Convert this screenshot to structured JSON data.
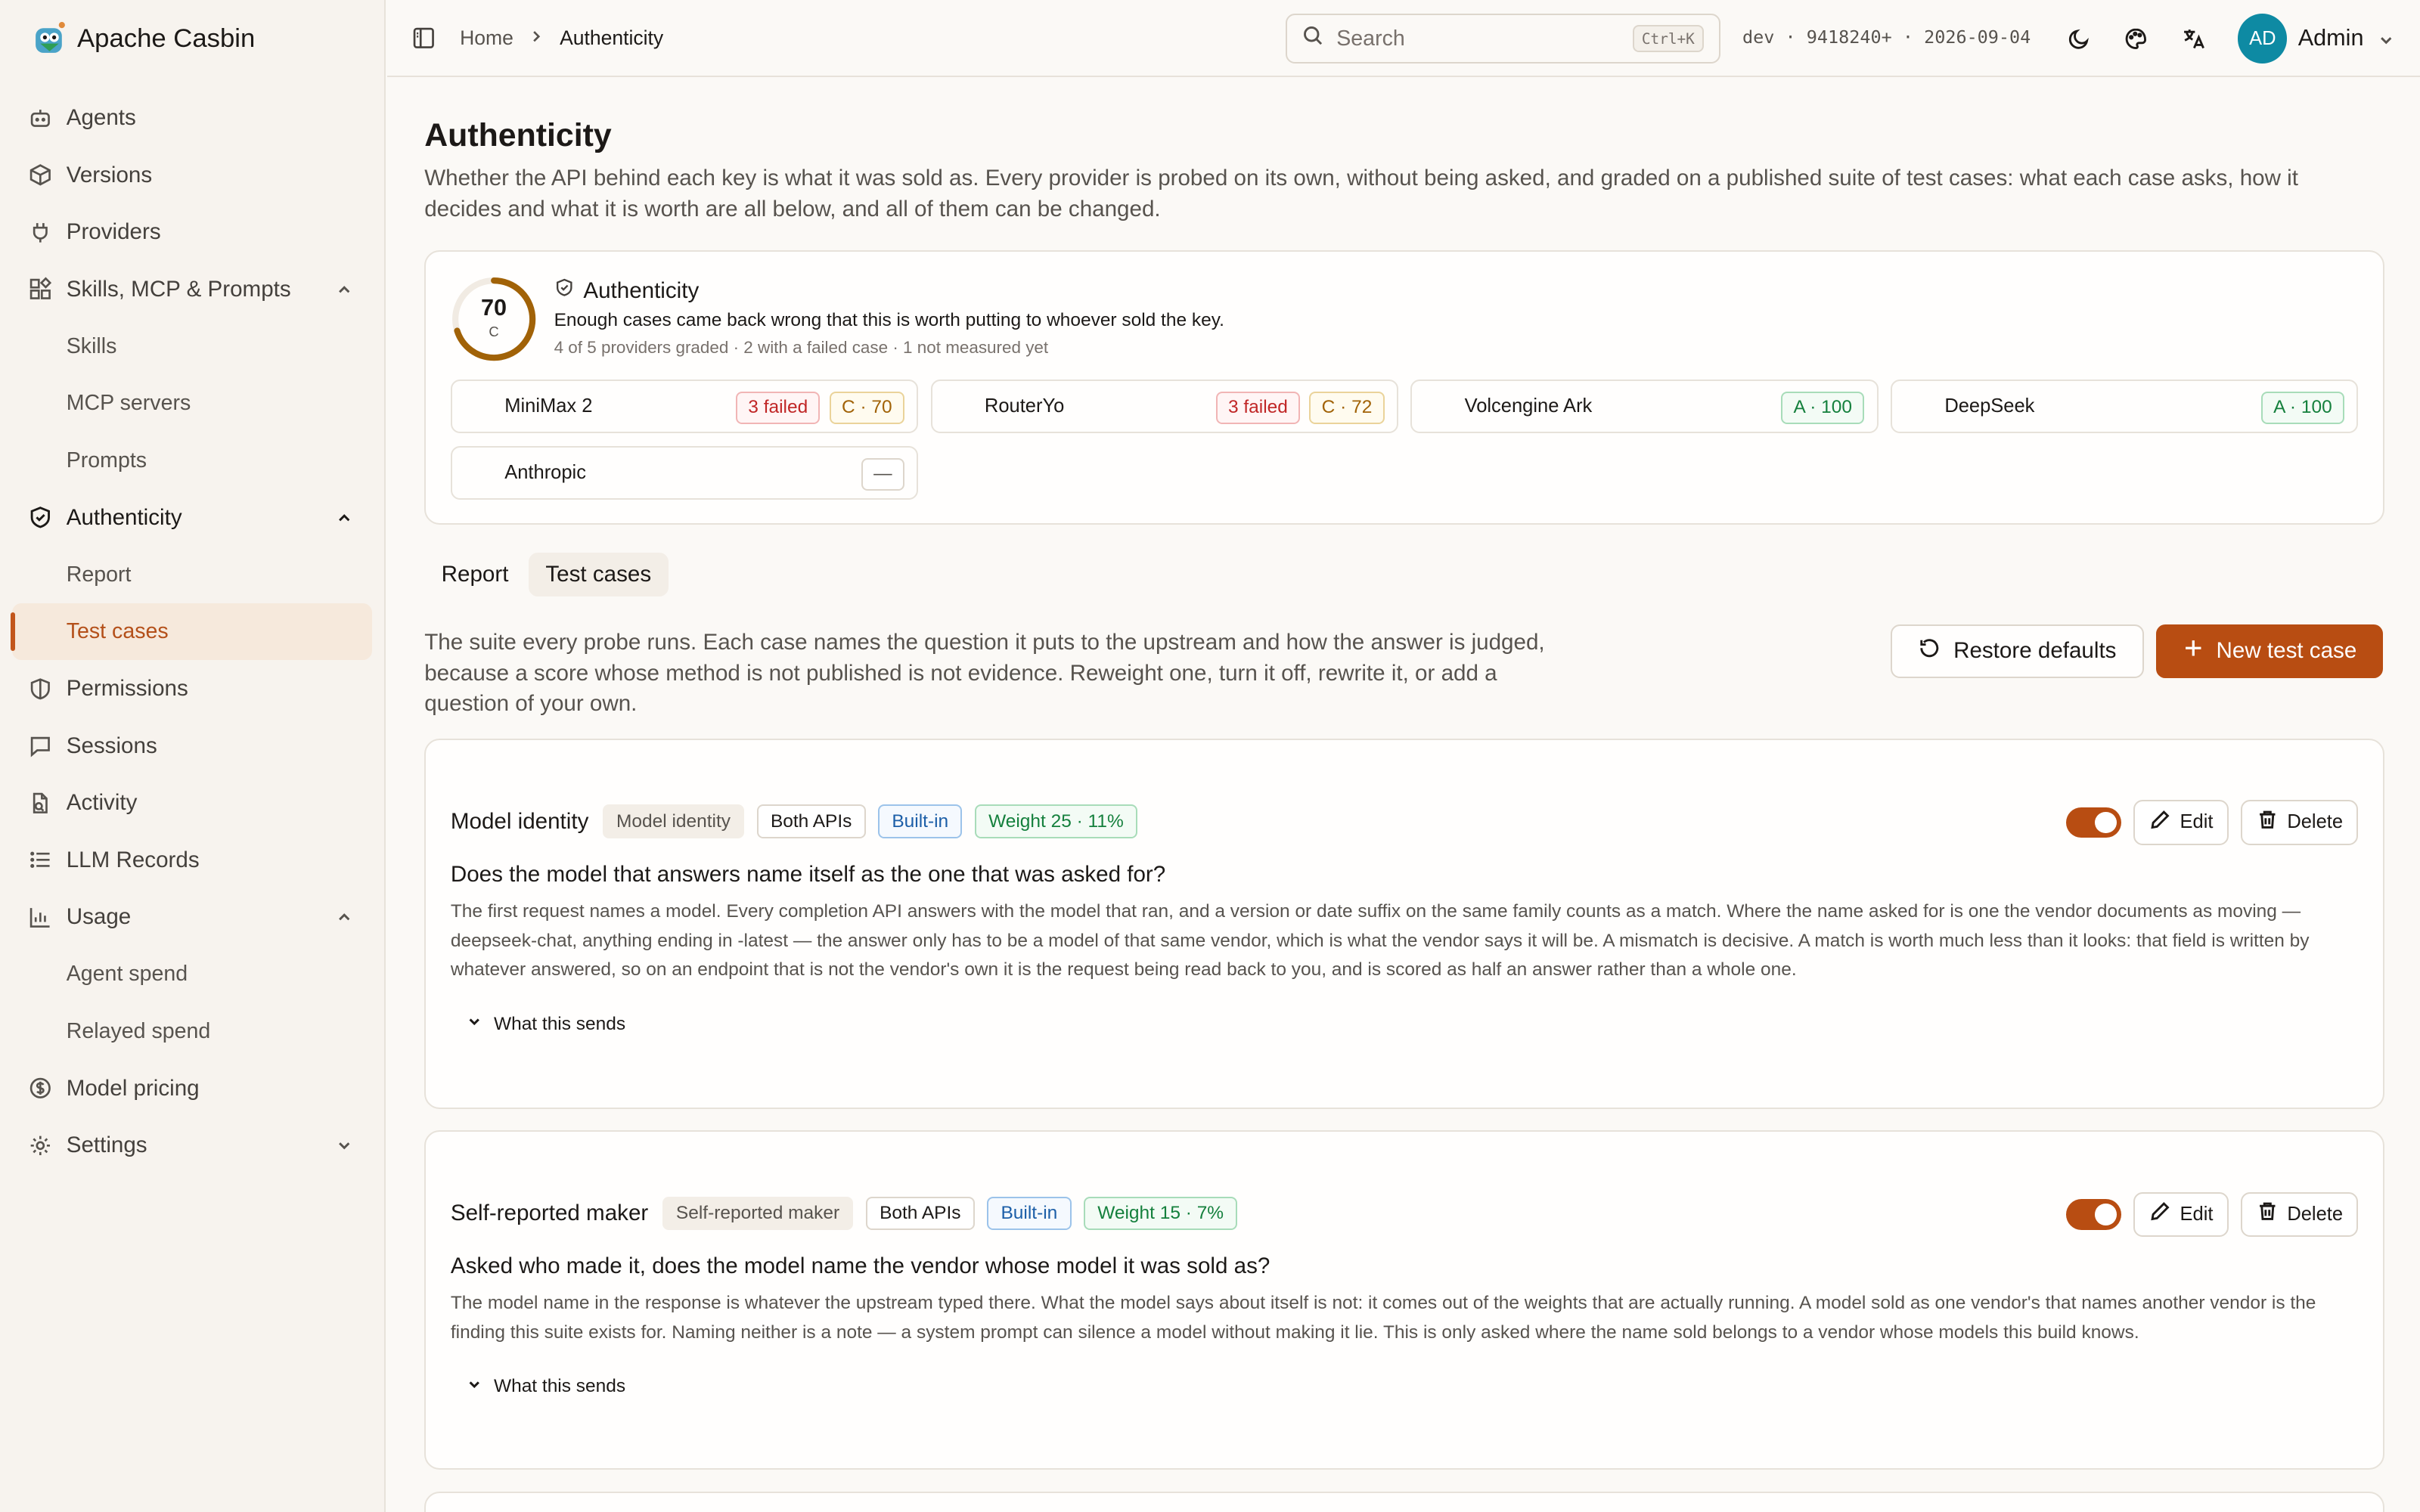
{
  "brand": {
    "name": "Apache Casbin"
  },
  "sidebar": {
    "items": [
      {
        "label": "Agents",
        "icon": "bot-icon"
      },
      {
        "label": "Versions",
        "icon": "package-icon"
      },
      {
        "label": "Providers",
        "icon": "plug-icon"
      },
      {
        "label": "Skills, MCP & Prompts",
        "icon": "blocks-icon",
        "expanded": true
      },
      {
        "label": "Skills",
        "sub": true
      },
      {
        "label": "MCP servers",
        "sub": true
      },
      {
        "label": "Prompts",
        "sub": true
      },
      {
        "label": "Authenticity",
        "icon": "shield-check-icon",
        "expanded": true
      },
      {
        "label": "Report",
        "sub": true
      },
      {
        "label": "Test cases",
        "sub": true,
        "active": true
      },
      {
        "label": "Permissions",
        "icon": "shield-icon"
      },
      {
        "label": "Sessions",
        "icon": "message-icon"
      },
      {
        "label": "Activity",
        "icon": "activity-icon"
      },
      {
        "label": "LLM Records",
        "icon": "list-icon"
      },
      {
        "label": "Usage",
        "icon": "bar-chart-icon",
        "expanded": true
      },
      {
        "label": "Agent spend",
        "sub": true
      },
      {
        "label": "Relayed spend",
        "sub": true
      },
      {
        "label": "Model pricing",
        "icon": "dollar-icon"
      },
      {
        "label": "Settings",
        "icon": "gear-icon",
        "collapsed": true
      }
    ]
  },
  "topbar": {
    "breadcrumb": [
      "Home",
      "Authenticity"
    ],
    "search_placeholder": "Search",
    "search_shortcut": "Ctrl+K",
    "build": "dev · 9418240+ · 2026-09-04",
    "avatar_initials": "AD",
    "user_name": "Admin"
  },
  "page": {
    "title": "Authenticity",
    "description": "Whether the API behind each key is what it was sold as. Every provider is probed on its own, without being asked, and graded on a published suite of test cases: what each case asks, how it decides and what it is worth are all below, and all of them can be changed."
  },
  "summary": {
    "score": "70",
    "grade": "C",
    "score_fraction": 0.7,
    "title": "Authenticity",
    "subtitle": "Enough cases came back wrong that this is worth putting to whoever sold the key.",
    "meta": "4 of 5 providers graded · 2 with a failed case · 1 not measured yet",
    "providers": [
      {
        "name": "MiniMax 2",
        "failed": "3 failed",
        "grade": "C · 70",
        "tone": "amber"
      },
      {
        "name": "RouterYo",
        "failed": "3 failed",
        "grade": "C · 72",
        "tone": "amber"
      },
      {
        "name": "Volcengine Ark",
        "failed": "",
        "grade": "A · 100",
        "tone": "green"
      },
      {
        "name": "DeepSeek",
        "failed": "",
        "grade": "A · 100",
        "tone": "green"
      },
      {
        "name": "Anthropic",
        "failed": "",
        "grade": "—",
        "tone": "gray"
      }
    ]
  },
  "tabs": [
    {
      "label": "Report",
      "active": false
    },
    {
      "label": "Test cases",
      "active": true
    }
  ],
  "suite": {
    "description": "The suite every probe runs. Each case names the question it puts to the upstream and how the answer is judged, because a score whose method is not published is not evidence. Reweight one, turn it off, rewrite it, or add a question of your own.",
    "restore_label": "Restore defaults",
    "new_label": "New test case"
  },
  "cases": [
    {
      "name": "Model identity",
      "kind": "Model identity",
      "api": "Both APIs",
      "origin": "Built-in",
      "weight": "Weight 25 · 11%",
      "enabled": true,
      "question": "Does the model that answers name itself as the one that was asked for?",
      "body": "The first request names a model. Every completion API answers with the model that ran, and a version or date suffix on the same family counts as a match. Where the name asked for is one the vendor documents as moving — deepseek-chat, anything ending in -latest — the answer only has to be a model of that same vendor, which is what the vendor says it will be. A mismatch is decisive. A match is worth much less than it looks: that field is written by whatever answered, so on an endpoint that is not the vendor's own it is the request being read back to you, and is scored as half an answer rather than a whole one.",
      "sends_label": "What this sends",
      "edit_label": "Edit",
      "delete_label": "Delete"
    },
    {
      "name": "Self-reported maker",
      "kind": "Self-reported maker",
      "api": "Both APIs",
      "origin": "Built-in",
      "weight": "Weight 15 · 7%",
      "enabled": true,
      "question": "Asked who made it, does the model name the vendor whose model it was sold as?",
      "body": "The model name in the response is whatever the upstream typed there. What the model says about itself is not: it comes out of the weights that are actually running. A model sold as one vendor's that names another vendor is the finding this suite exists for. Naming neither is a note — a system prompt can silence a model without making it lie. This is only asked where the name sold belongs to a vendor whose models this build knows.",
      "sends_label": "What this sends",
      "edit_label": "Edit",
      "delete_label": "Delete"
    }
  ],
  "colors": {
    "accent": "#b84d12",
    "active_bg": "#f6e9dc",
    "ring": "#a16207"
  }
}
